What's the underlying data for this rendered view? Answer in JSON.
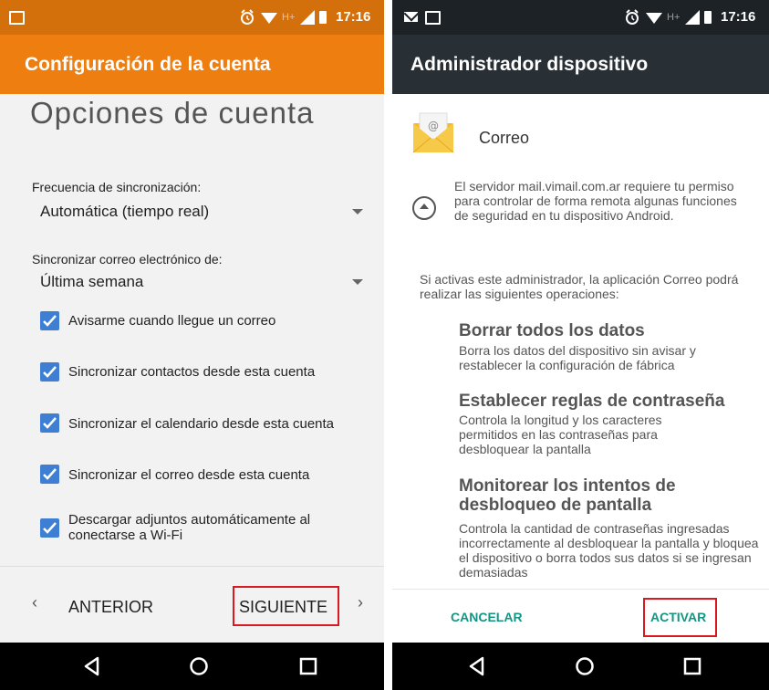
{
  "left": {
    "status": {
      "time": "17:16",
      "network": "H+"
    },
    "app_bar_title": "Configuración de la cuenta",
    "page_title": "Opciones de cuenta",
    "sync_frequency": {
      "label": "Frecuencia de sincronización:",
      "value": "Automática (tiempo real)"
    },
    "sync_range": {
      "label": "Sincronizar correo electrónico de:",
      "value": "Última semana"
    },
    "checkboxes": [
      {
        "label": "Avisarme cuando llegue un correo",
        "checked": true
      },
      {
        "label": "Sincronizar contactos desde esta cuenta",
        "checked": true
      },
      {
        "label": "Sincronizar el calendario desde esta cuenta",
        "checked": true
      },
      {
        "label": "Sincronizar el correo desde esta cuenta",
        "checked": true
      },
      {
        "label": "Descargar adjuntos automáticamente al conectarse a Wi-Fi",
        "checked": true
      }
    ],
    "nav": {
      "prev_label": "ANTERIOR",
      "next_label": "SIGUIENTE",
      "prev_chevron": "‹",
      "next_chevron": "›"
    }
  },
  "right": {
    "status": {
      "time": "17:16",
      "network": "H+"
    },
    "app_bar_title": "Administrador dispositivo",
    "app_name": "Correo",
    "server_message": "El servidor mail.vimail.com.ar requiere tu permiso para controlar de forma remota algunas funciones de seguridad en tu dispositivo Android.",
    "intro": "Si activas este administrador, la aplicación Correo podrá realizar las siguientes operaciones:",
    "operations": [
      {
        "title": "Borrar todos los datos",
        "description": "Borra los datos del dispositivo sin avisar y restablecer la configuración de fábrica"
      },
      {
        "title": "Establecer reglas de contraseña",
        "description": "Controla la longitud y los caracteres permitidos en las contraseñas para desbloquear la pantalla"
      },
      {
        "title": "Monitorear los intentos de desbloqueo de pantalla",
        "description": "Controla la cantidad de contraseñas ingresadas incorrectamente al desbloquear la pantalla y bloquea el dispositivo o borra todos sus datos si se ingresan demasiadas"
      }
    ],
    "cancel_label": "CANCELAR",
    "activate_label": "ACTIVAR"
  },
  "colors": {
    "orange_appbar": "#ee7e0f",
    "orange_statusbar": "#d4700c",
    "dark_appbar": "#283036",
    "dark_statusbar": "#1d2226",
    "checkbox_blue": "#3e7fd4",
    "action_teal": "#129682",
    "highlight_red": "#d9191f"
  },
  "icons": {
    "status": [
      "image-icon",
      "mail-icon",
      "alarm-icon",
      "wifi-icon",
      "signal-icon",
      "battery-icon"
    ],
    "navigation": [
      "back-icon",
      "home-icon",
      "recents-icon"
    ],
    "content": [
      "email-app-icon",
      "collapse-icon",
      "dropdown-arrow-icon",
      "checkbox-icon"
    ]
  }
}
